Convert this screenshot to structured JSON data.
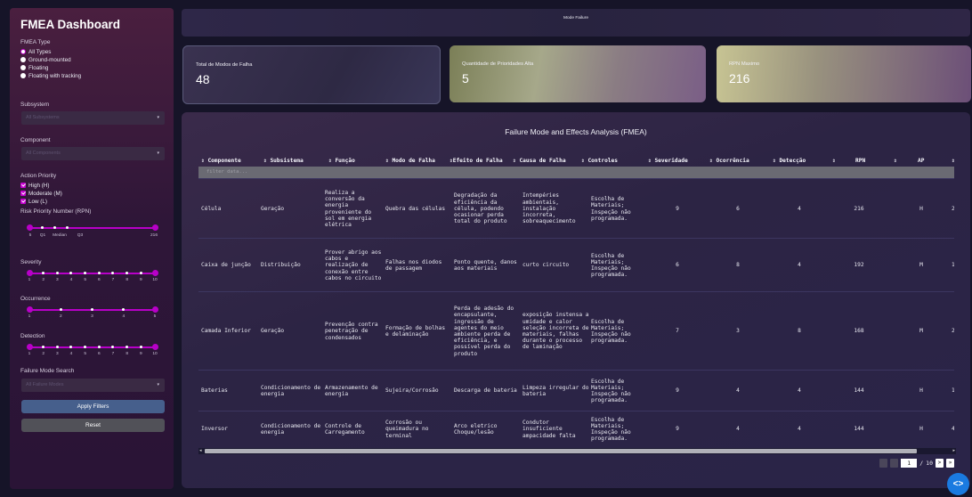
{
  "sidebar": {
    "title": "FMEA Dashboard",
    "fmea_type_label": "FMEA Type",
    "fmea_types": [
      "All Types",
      "Ground-mounted",
      "Floating",
      "Floating with tracking"
    ],
    "subsystem_label": "Subsystem",
    "subsystem_placeholder": "All Subsystems",
    "component_label": "Component",
    "component_placeholder": "All Components",
    "action_priority_label": "Action Priority",
    "action_priorities": [
      "High (H)",
      "Moderate (M)",
      "Low (L)"
    ],
    "rpn_label": "Risk Priority Number (RPN)",
    "rpn_ticks": [
      "5",
      "Q1",
      "Median",
      "Q3",
      "216"
    ],
    "severity_label": "Severity",
    "severity_ticks": [
      "1",
      "2",
      "3",
      "4",
      "5",
      "6",
      "7",
      "8",
      "9",
      "10"
    ],
    "occurrence_label": "Occurrence",
    "occurrence_ticks": [
      "1",
      "2",
      "3",
      "4",
      "5"
    ],
    "detection_label": "Detection",
    "detection_ticks": [
      "1",
      "2",
      "3",
      "4",
      "5",
      "6",
      "7",
      "8",
      "9",
      "10"
    ],
    "failure_search_label": "Failure Mode Search",
    "failure_search_placeholder": "All Failure Modes",
    "apply_label": "Apply Filters",
    "reset_label": "Reset"
  },
  "banner": {
    "text": "Mode Failure"
  },
  "cards": [
    {
      "label": "Total de Modos de Falha",
      "value": "48"
    },
    {
      "label": "Quantidade de Prioridades Alta",
      "value": "5"
    },
    {
      "label": "RPN Maximo",
      "value": "216"
    }
  ],
  "table": {
    "title": "Failure Mode and Effects Analysis (FMEA)",
    "filter_placeholder": "filter data...",
    "headers": [
      "⇕ Componente",
      "⇕ Subsistema",
      "⇕ Função",
      "⇕ Modo de Falha",
      "⇕Efeito de Falha",
      "⇕ Causa de Falha",
      "⇕ Controles",
      "⇕ Severidade",
      "⇕ Ocorrência",
      "⇕ Detecção",
      "⇕",
      "RPN",
      "⇕",
      "AP",
      "⇕"
    ],
    "rows": [
      [
        "Célula",
        "Geração",
        "Realiza a conversão da energia proveniente do sol em energia elétrica",
        "Quebra das células",
        "Degradação da eficiência da célula, podendo ocasionar perda total do produto",
        "Intempéries ambientais, instalação incorreta, sobreaquecimento",
        "Escolha de Materiais; Inspeção não programada.",
        "9",
        "6",
        "4",
        "216",
        "H",
        "2"
      ],
      [
        "Caixa de junção",
        "Distribuição",
        "Prover abrigo aos cabos e realização de conexão entre cabos no circuito",
        "Falhas nos diodos de passagem",
        "Ponto quente, danos aos materiais",
        "curto circuito",
        "Escolha de Materiais; Inspeção não programada.",
        "6",
        "8",
        "4",
        "192",
        "M",
        "1"
      ],
      [
        "Camada Inferior",
        "Geração",
        "Prevenção contra penetração de condensados",
        "Formação de bolhas e delaminação",
        "Perda de adesão do encapsulante, ingressão de agentes do meio ambiente perda de eficiência, e possível perda do produto",
        "exposição instensa a umidade e calor seleção incorreta de materiais, falhas durante o processo de laminação",
        "Escolha de Materiais; Inspeção não programada.",
        "7",
        "3",
        "8",
        "168",
        "M",
        "2"
      ],
      [
        "Baterias",
        "Condicionamento de energia",
        "Armazenamento de energia",
        "Sujeira/Corrosão",
        "Descarga de bateria",
        "Limpeza irregular do bateria",
        "Escolha de Materiais; Inspeção não programada.",
        "9",
        "4",
        "4",
        "144",
        "H",
        "1"
      ],
      [
        "Inversor",
        "Condicionamento de energia",
        "Controle de Carregamento",
        "Corrosão ou queimadura no terminal",
        "Arco eletrico Choque/lesão",
        "Condutor insuficiente ampacidade falta",
        "Escolha de Materiais; Inspeção não programada.",
        "9",
        "4",
        "4",
        "144",
        "H",
        "4"
      ]
    ]
  },
  "pagination": {
    "current": "1",
    "separator": "/",
    "total": "10",
    "next": ">",
    "last": "»"
  },
  "fab": {
    "label": "<>"
  },
  "colors": {
    "accent": "#c600d0",
    "apply": "#465f8c",
    "reset": "#515158",
    "fab": "#1a7ae0"
  }
}
